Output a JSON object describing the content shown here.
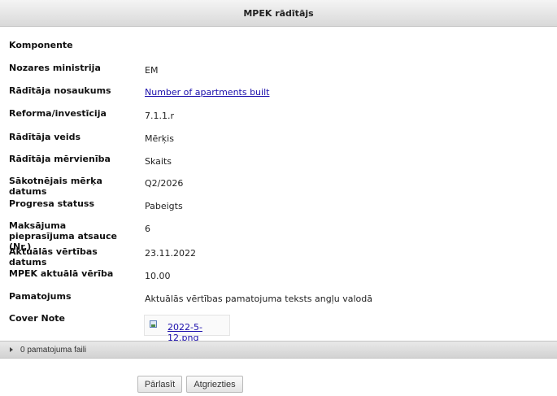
{
  "header": {
    "title": "MPEK rādītājs"
  },
  "fields": [
    {
      "label": "Komponente",
      "value": ""
    },
    {
      "label": "Nozares ministrija",
      "value": "EM"
    },
    {
      "label": "Rādītāja nosaukums",
      "value": "Number of apartments built"
    },
    {
      "label": "Reforma/investīcija",
      "value": "7.1.1.r"
    },
    {
      "label": "Rādītāja veids",
      "value": "Mērķis"
    },
    {
      "label": "Rādītāja mērvienība",
      "value": "Skaits"
    },
    {
      "label": "Sākotnējais mērķa datums",
      "value": "Q2/2026"
    },
    {
      "label": "Progresa statuss",
      "value": "Pabeigts"
    },
    {
      "label": "Maksājuma pieprasījuma atsauce (Nr.)",
      "value": "6"
    },
    {
      "label": "Aktuālās vērtības datums",
      "value": "23.11.2022"
    },
    {
      "label": "MPEK aktuālā vērība",
      "value": "10.00"
    },
    {
      "label": "Pamatojums",
      "value": "Aktuālās vērtības pamatojuma teksts angļu valodā"
    },
    {
      "label": "Cover Note",
      "value": ""
    }
  ],
  "cover_note_file": {
    "name": "2022-5-12.png",
    "icon": "image-file-icon"
  },
  "attachments": {
    "label": "0 pamatojuma faili",
    "icon": "caret-right-icon"
  },
  "buttons": {
    "browse": "Pārlasīt",
    "back": "Atgriezties"
  }
}
